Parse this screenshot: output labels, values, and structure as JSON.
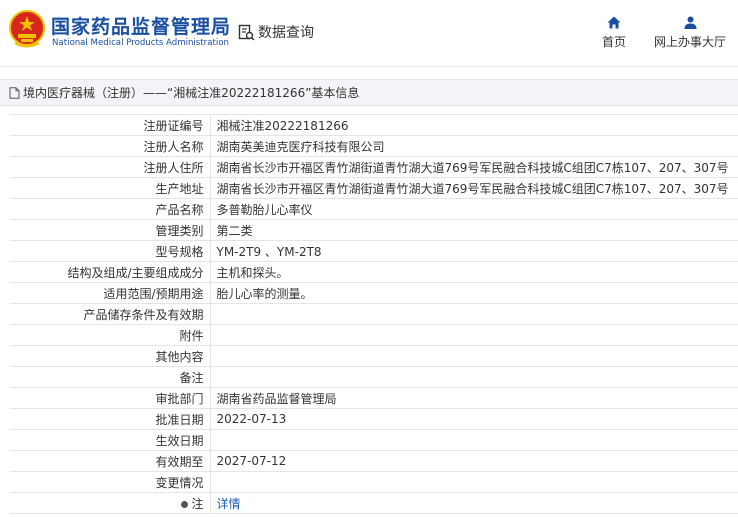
{
  "header": {
    "org_name_cn": "国家药品监督管理局",
    "org_name_en": "National Medical Products Administration",
    "query_label": "数据查询",
    "nav": [
      {
        "label": "首页",
        "icon": "home-icon"
      },
      {
        "label": "网上办事大厅",
        "icon": "user-icon"
      }
    ]
  },
  "section": {
    "title": "境内医疗器械（注册）——“湘械注准20222181266”基本信息"
  },
  "rows": [
    {
      "label": "注册证编号",
      "value": "湘械注准20222181266"
    },
    {
      "label": "注册人名称",
      "value": "湖南英美迪克医疗科技有限公司"
    },
    {
      "label": "注册人住所",
      "value": "湖南省长沙市开福区青竹湖街道青竹湖大道769号军民融合科技城C组团C7栋107、207、307号"
    },
    {
      "label": "生产地址",
      "value": "湖南省长沙市开福区青竹湖街道青竹湖大道769号军民融合科技城C组团C7栋107、207、307号"
    },
    {
      "label": "产品名称",
      "value": "多普勒胎儿心率仪"
    },
    {
      "label": "管理类别",
      "value": "第二类"
    },
    {
      "label": "型号规格",
      "value": "YM-2T9 、YM-2T8"
    },
    {
      "label": "结构及组成/主要组成成分",
      "value": "主机和探头。"
    },
    {
      "label": "适用范围/预期用途",
      "value": "胎儿心率的测量。"
    },
    {
      "label": "产品储存条件及有效期",
      "value": ""
    },
    {
      "label": "附件",
      "value": ""
    },
    {
      "label": "其他内容",
      "value": ""
    },
    {
      "label": "备注",
      "value": ""
    },
    {
      "label": "审批部门",
      "value": "湖南省药品监督管理局"
    },
    {
      "label": "批准日期",
      "value": "2022-07-13"
    },
    {
      "label": "生效日期",
      "value": ""
    },
    {
      "label": "有效期至",
      "value": "2027-07-12"
    },
    {
      "label": "变更情况",
      "value": ""
    },
    {
      "label": "注",
      "value": "详情"
    }
  ],
  "colors": {
    "brand_blue": "#1a4fa0",
    "emblem_red": "#d7261e",
    "emblem_gold": "#f2c200",
    "link_blue": "#1a5fb4"
  }
}
